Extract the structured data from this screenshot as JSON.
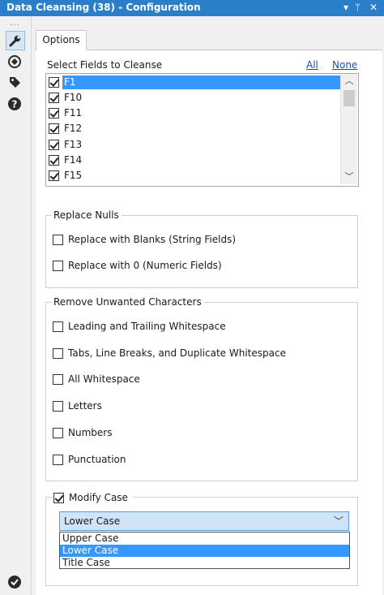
{
  "window": {
    "title": "Data Cleansing (38) - Configuration",
    "controls": [
      "▾",
      "ᛘ",
      "✕"
    ]
  },
  "rail": {
    "dots": "...",
    "items": [
      "wrench-icon",
      "globe-icon",
      "tag-icon",
      "help-icon",
      "check-icon"
    ]
  },
  "tabs": [
    {
      "label": "Options",
      "active": true
    }
  ],
  "fields": {
    "label": "Select Fields to Cleanse",
    "all_link": "All",
    "none_link": "None",
    "items": [
      {
        "name": "F1",
        "checked": true,
        "selected": true
      },
      {
        "name": "F10",
        "checked": true
      },
      {
        "name": "F11",
        "checked": true
      },
      {
        "name": "F12",
        "checked": true
      },
      {
        "name": "F13",
        "checked": true
      },
      {
        "name": "F14",
        "checked": true
      },
      {
        "name": "F15",
        "checked": true
      }
    ]
  },
  "replace_nulls": {
    "title": "Replace Nulls",
    "options": [
      {
        "label": "Replace with Blanks (String Fields)",
        "checked": false
      },
      {
        "label": "Replace with 0 (Numeric Fields)",
        "checked": false
      }
    ]
  },
  "remove_chars": {
    "title": "Remove Unwanted Characters",
    "options": [
      {
        "label": "Leading and Trailing Whitespace",
        "checked": false
      },
      {
        "label": "Tabs, Line Breaks, and Duplicate Whitespace",
        "checked": false
      },
      {
        "label": "All Whitespace",
        "checked": false
      },
      {
        "label": "Letters",
        "checked": false
      },
      {
        "label": "Numbers",
        "checked": false
      },
      {
        "label": "Punctuation",
        "checked": false
      }
    ]
  },
  "modify_case": {
    "title": "Modify Case",
    "checked": true,
    "selected": "Lower Case",
    "options": [
      "Upper Case",
      "Lower Case",
      "Title Case"
    ],
    "highlighted_index": 1
  },
  "colors": {
    "title_bar": "#2b7fc8",
    "selection": "#3399ff",
    "link": "#1a4fb0"
  }
}
